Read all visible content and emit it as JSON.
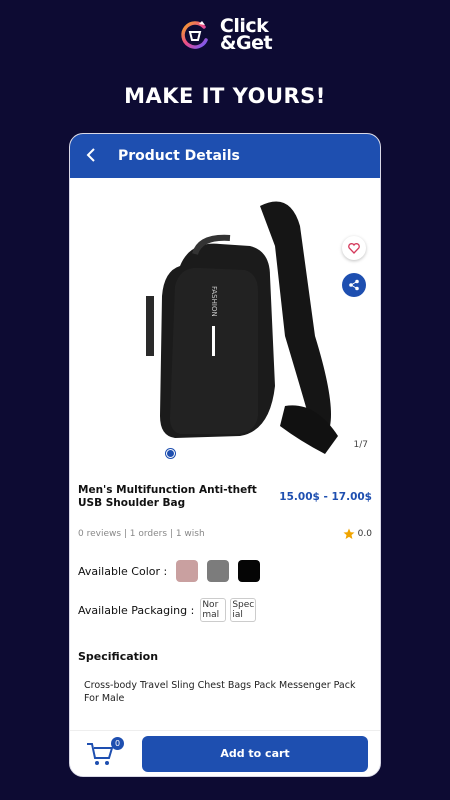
{
  "brand": {
    "line1": "Click",
    "line2": "&Get"
  },
  "tagline": "MAKE IT YOURS!",
  "header": {
    "back_icon": "chevron-left-icon",
    "title": "Product Details"
  },
  "gallery": {
    "counter": "1/7",
    "dot_count": 7,
    "active_index": 0
  },
  "product": {
    "name": "Men's Multifunction Anti-theft USB Shoulder Bag",
    "price": "15.00$ - 17.00$",
    "stats": "0 reviews | 1 orders | 1 wish",
    "rating": "0.0",
    "color_label": "Available Color :",
    "colors": [
      "#c9a0a0",
      "#7c7c7c",
      "#050505"
    ],
    "packaging_label": "Available Packaging :",
    "packaging": [
      "Nor mal",
      "Spec ial"
    ],
    "spec_heading": "Specification",
    "spec_text": "Cross-body Travel Sling Chest Bags Pack Messenger Pack For Male"
  },
  "bottom": {
    "cart_count": "0",
    "add_label": "Add to cart"
  },
  "colors": {
    "background": "#0d0b33",
    "accent": "#1e4fb0",
    "price": "#1e4fb0"
  }
}
